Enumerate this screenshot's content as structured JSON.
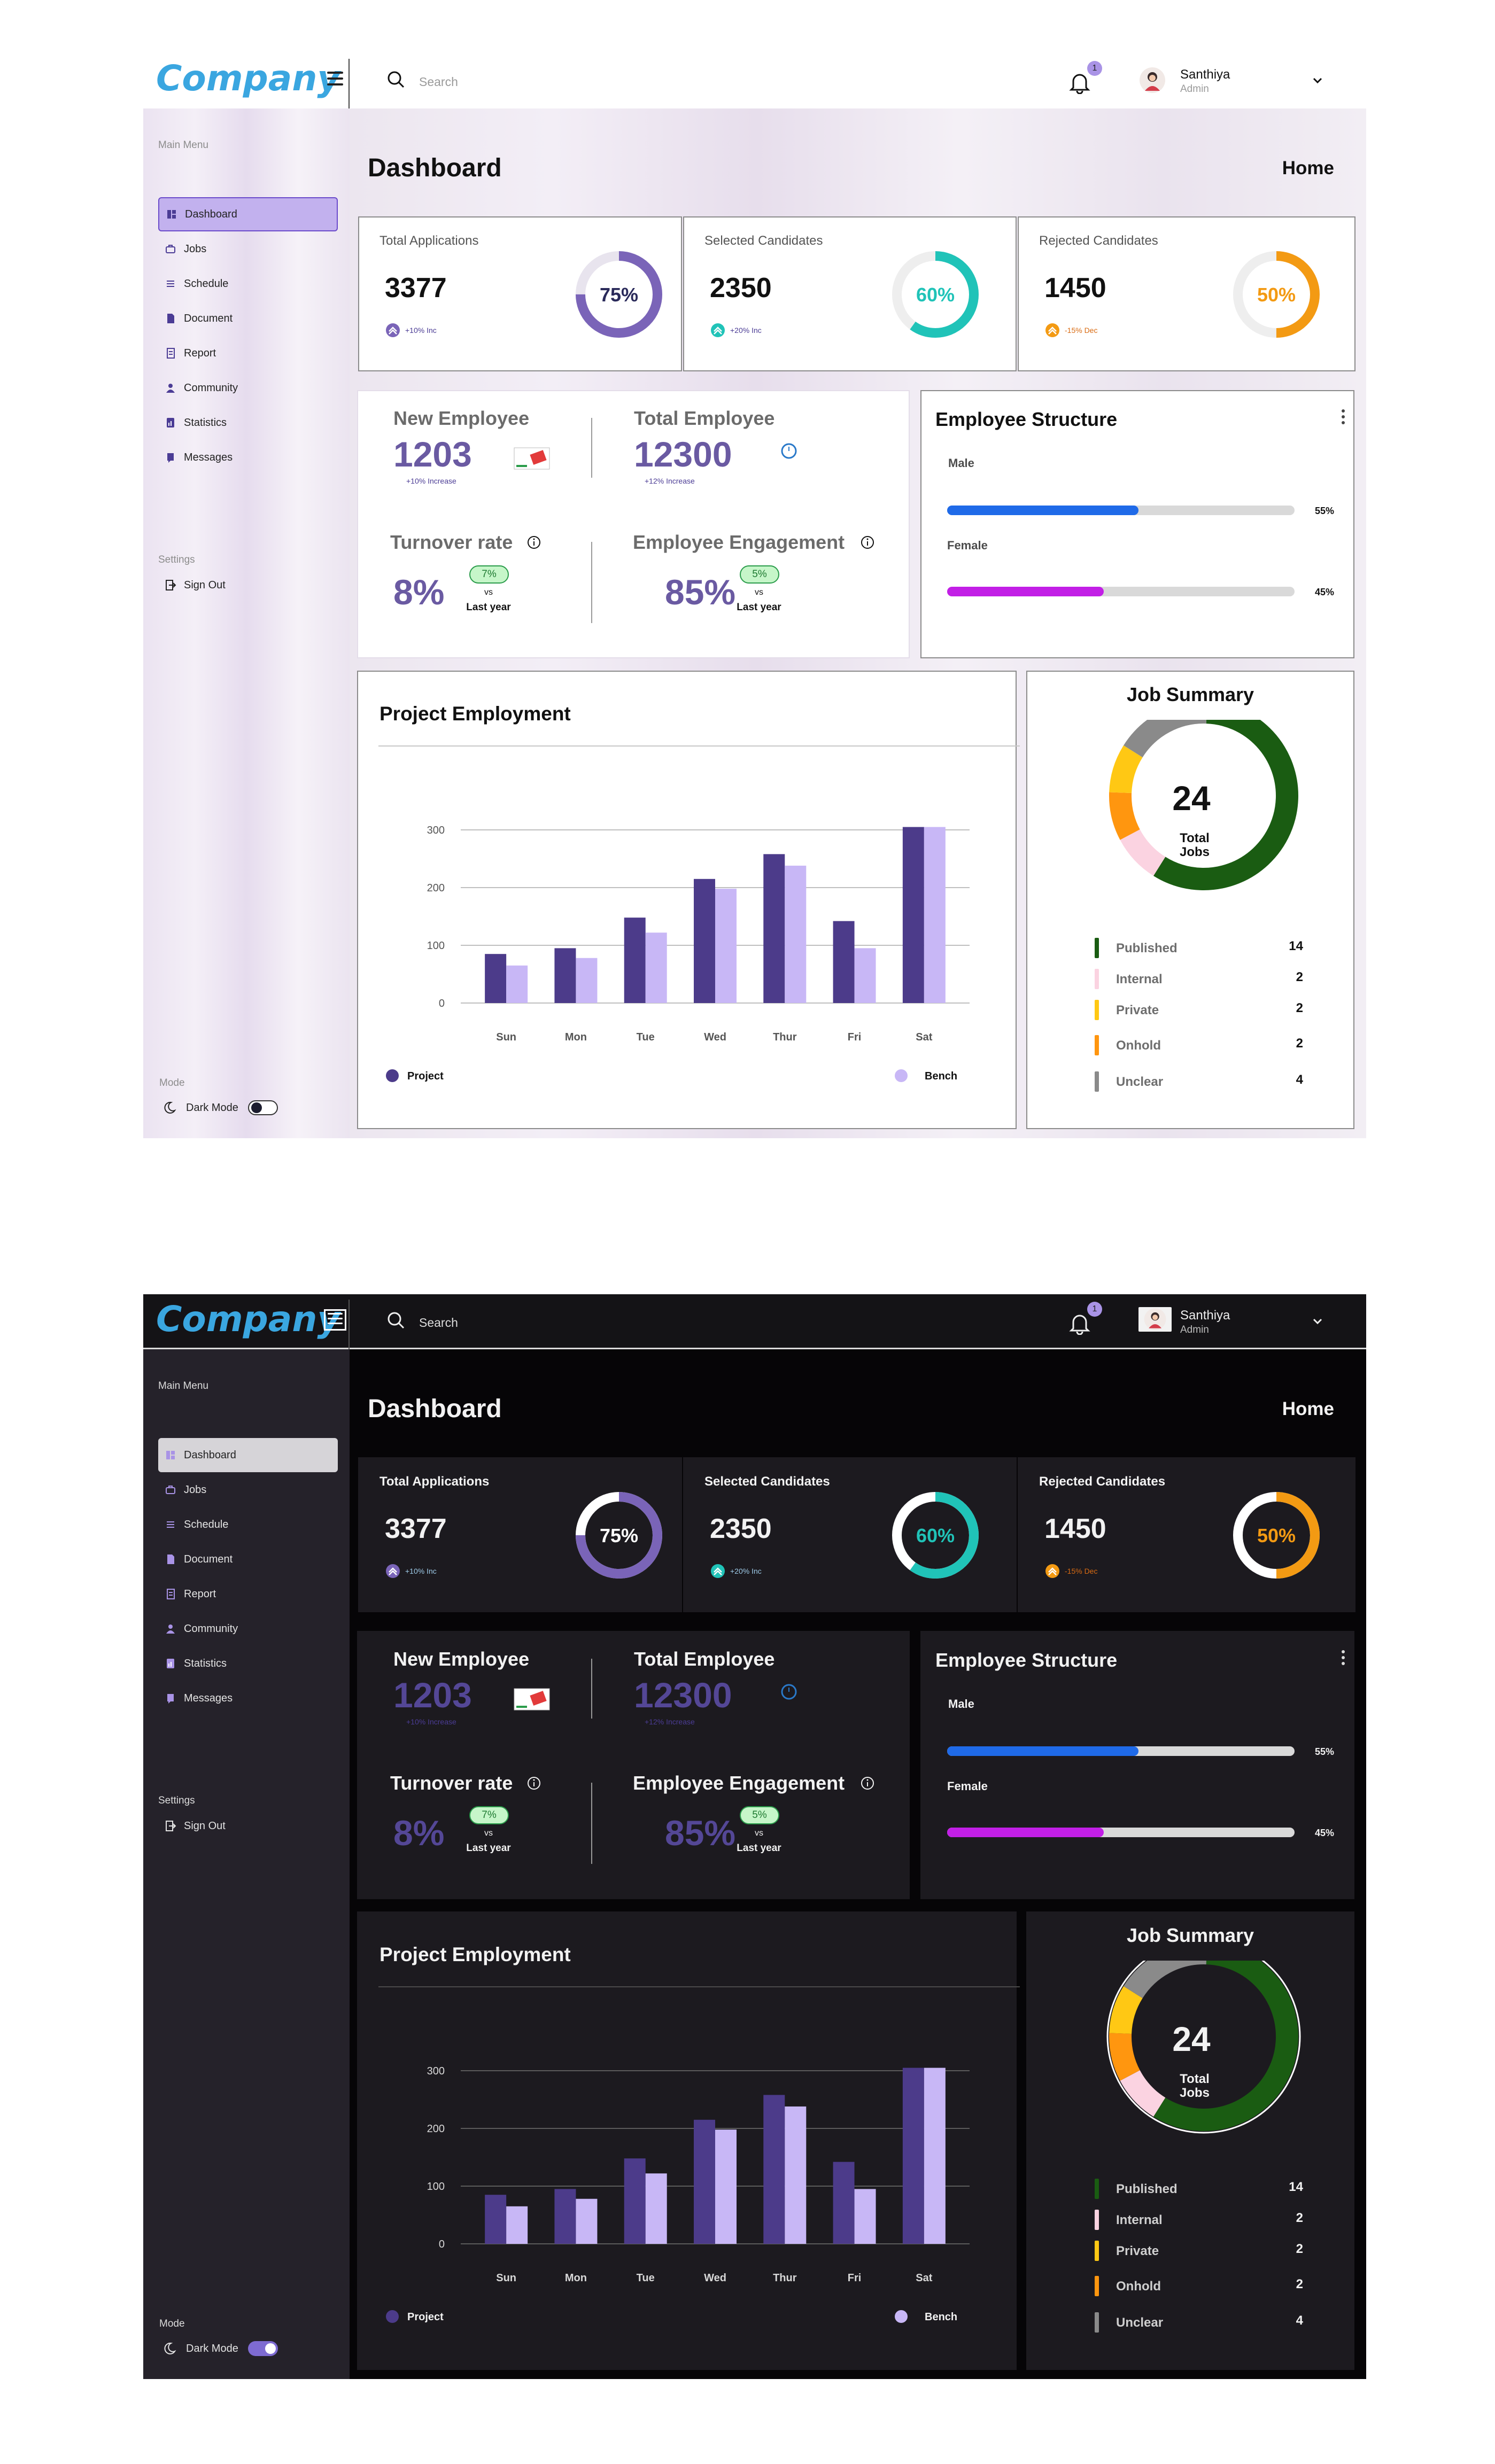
{
  "brand": "Company",
  "search": {
    "placeholder": "Search"
  },
  "notifications": {
    "count": "1"
  },
  "user": {
    "name": "Santhiya",
    "role": "Admin"
  },
  "sidebar": {
    "main_menu_title": "Main Menu",
    "items": [
      {
        "label": "Dashboard",
        "icon": "grid-icon"
      },
      {
        "label": "Jobs",
        "icon": "briefcase-icon"
      },
      {
        "label": "Schedule",
        "icon": "list-icon"
      },
      {
        "label": "Document",
        "icon": "document-icon"
      },
      {
        "label": "Report",
        "icon": "report-icon"
      },
      {
        "label": "Community",
        "icon": "person-icon"
      },
      {
        "label": "Statistics",
        "icon": "statistics-icon"
      },
      {
        "label": "Messages",
        "icon": "message-icon"
      }
    ],
    "settings_title": "Settings",
    "sign_out": "Sign Out",
    "mode_title": "Mode",
    "dark_mode": "Dark Mode"
  },
  "page": {
    "title": "Dashboard",
    "breadcrumb": "Home"
  },
  "stats": [
    {
      "title": "Total Applications",
      "value": "3377",
      "change": "+10% Inc",
      "percent": "75%",
      "fill": 0.75,
      "color": "#7a64b8",
      "track": "#e8e4ee"
    },
    {
      "title": "Selected Candidates",
      "value": "2350",
      "change": "+20% Inc",
      "percent": "60%",
      "fill": 0.6,
      "color": "#20c3b8",
      "track": "#eeeeee"
    },
    {
      "title": "Rejected Candidates",
      "value": "1450",
      "change": "-15% Dec",
      "percent": "50%",
      "fill": 0.5,
      "color": "#f39a13",
      "track": "#eeeeee"
    }
  ],
  "employee": {
    "new_label": "New Employee",
    "new_value": "1203",
    "new_sub": "+10% Increase",
    "total_label": "Total Employee",
    "total_value": "12300",
    "total_sub": "+12% Increase",
    "turnover_label": "Turnover rate",
    "turnover_value": "8%",
    "turnover_change": "7%",
    "engagement_label": "Employee Engagement",
    "engagement_value": "85%",
    "engagement_change": "5%",
    "vs": "vs",
    "last_year": "Last year"
  },
  "structure": {
    "title": "Employee Structure",
    "male_label": "Male",
    "male_pct": "55%",
    "male_fill": 0.55,
    "male_color": "#1f6ae8",
    "female_label": "Female",
    "female_pct": "45%",
    "female_fill": 0.45,
    "female_color": "#c21fe6"
  },
  "project": {
    "title": "Project Employment",
    "legend_project": "Project",
    "legend_bench": "Bench",
    "colors": {
      "project": "#4c3b8a",
      "bench": "#c8b7f6"
    }
  },
  "chart_data": {
    "type": "bar",
    "categories": [
      "Sun",
      "Mon",
      "Tue",
      "Wed",
      "Thur",
      "Fri",
      "Sat"
    ],
    "series": [
      {
        "name": "Project",
        "values": [
          85,
          95,
          148,
          215,
          258,
          142,
          305
        ]
      },
      {
        "name": "Bench",
        "values": [
          65,
          78,
          122,
          198,
          238,
          95,
          305
        ]
      }
    ],
    "ylim": [
      0,
      300
    ],
    "yticks": [
      "0",
      "100",
      "200",
      "300"
    ],
    "legend": "bottom"
  },
  "job_summary": {
    "title": "Job Summary",
    "total": "24",
    "total_label_1": "Total",
    "total_label_2": "Jobs",
    "items": [
      {
        "label": "Published",
        "count": "14",
        "value": 14,
        "color": "#1a5c12"
      },
      {
        "label": "Internal",
        "count": "2",
        "value": 2,
        "color": "#fbd3e1"
      },
      {
        "label": "Private",
        "count": "2",
        "value": 2,
        "color": "#ffc814"
      },
      {
        "label": "Onhold",
        "count": "2",
        "value": 2,
        "color": "#ff960f"
      },
      {
        "label": "Unclear",
        "count": "4",
        "value": 4,
        "color": "#8a8a8a"
      }
    ]
  }
}
